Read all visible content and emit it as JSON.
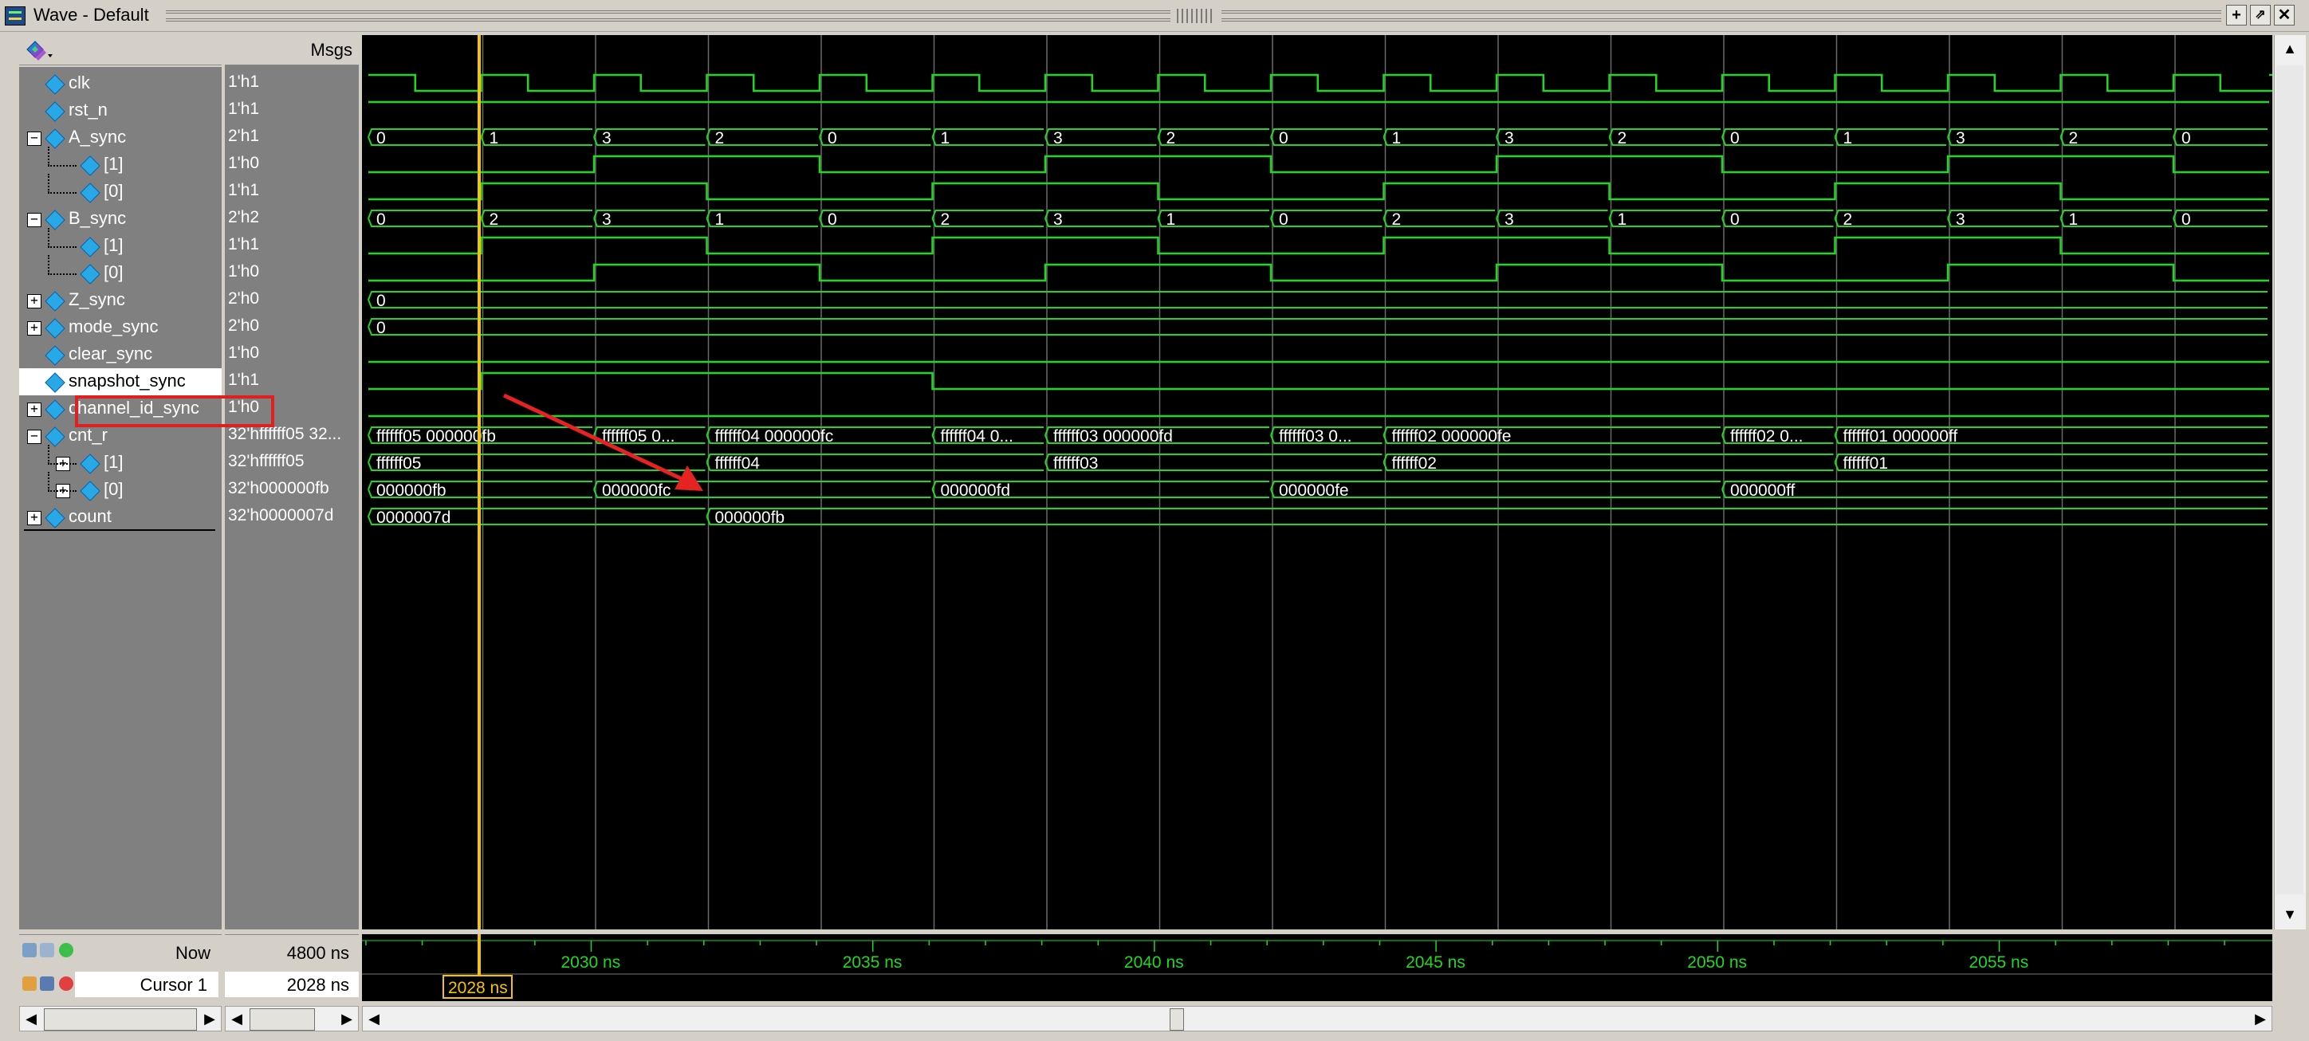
{
  "window": {
    "title": "Wave - Default"
  },
  "headers": {
    "msgs": "Msgs"
  },
  "signals": [
    {
      "name": "clk",
      "value": "1'h1",
      "expand": "",
      "level": 0
    },
    {
      "name": "rst_n",
      "value": "1'h1",
      "expand": "",
      "level": 0
    },
    {
      "name": "A_sync",
      "value": "2'h1",
      "expand": "-",
      "level": 0
    },
    {
      "name": "[1]",
      "value": "1'h0",
      "expand": "",
      "level": 1
    },
    {
      "name": "[0]",
      "value": "1'h1",
      "expand": "",
      "level": 1
    },
    {
      "name": "B_sync",
      "value": "2'h2",
      "expand": "-",
      "level": 0
    },
    {
      "name": "[1]",
      "value": "1'h1",
      "expand": "",
      "level": 1
    },
    {
      "name": "[0]",
      "value": "1'h0",
      "expand": "",
      "level": 1
    },
    {
      "name": "Z_sync",
      "value": "2'h0",
      "expand": "+",
      "level": 0
    },
    {
      "name": "mode_sync",
      "value": "2'h0",
      "expand": "+",
      "level": 0
    },
    {
      "name": "clear_sync",
      "value": "1'h0",
      "expand": "",
      "level": 0
    },
    {
      "name": "snapshot_sync",
      "value": "1'h1",
      "expand": "",
      "level": 0
    },
    {
      "name": "channel_id_sync",
      "value": "1'h0",
      "expand": "+",
      "level": 0
    },
    {
      "name": "cnt_r",
      "value": "32'hffffff05 32...",
      "expand": "-",
      "level": 0
    },
    {
      "name": "[1]",
      "value": "32'hffffff05",
      "expand": "+",
      "level": 1
    },
    {
      "name": "[0]",
      "value": "32'h000000fb",
      "expand": "+",
      "level": 1
    },
    {
      "name": "count",
      "value": "32'h0000007d",
      "expand": "+",
      "level": 0
    }
  ],
  "wave_labels": {
    "A_sync": [
      "0",
      "1",
      "3",
      "2",
      "0",
      "1",
      "3",
      "2",
      "0",
      "1",
      "3",
      "2",
      "0",
      "1",
      "3",
      "2",
      "0"
    ],
    "B_sync": [
      "0",
      "2",
      "3",
      "1",
      "0",
      "2",
      "3",
      "1",
      "0",
      "2",
      "3",
      "1",
      "0",
      "2",
      "3",
      "1",
      "0"
    ],
    "Z_sync": [
      "0"
    ],
    "mode_sync": [
      "0"
    ],
    "cnt_r": [
      "ffffff05 000000fb",
      "ffffff05 0...",
      "ffffff04 000000fc",
      "ffffff04 0...",
      "ffffff03 000000fd",
      "ffffff03 0...",
      "ffffff02 000000fe",
      "ffffff02 0...",
      "ffffff01 000000ff"
    ],
    "cnt_r_1": [
      "ffffff05",
      "ffffff04",
      "ffffff03",
      "ffffff02",
      "ffffff01"
    ],
    "cnt_r_0": [
      "000000fb",
      "000000fc",
      "000000fd",
      "000000fe",
      "000000ff"
    ],
    "count": [
      "0000007d",
      "000000fb"
    ]
  },
  "timeline": {
    "ticks": [
      "2030 ns",
      "2035 ns",
      "2040 ns",
      "2045 ns",
      "2050 ns",
      "2055 ns"
    ],
    "now_label": "Now",
    "now_value": "4800 ns",
    "cursor_label": "Cursor 1",
    "cursor_value": "2028 ns",
    "cursor_tag": "2028 ns"
  },
  "colors": {
    "wave": "#21d821",
    "cursor": "#f5c400",
    "highlight": "#e02020",
    "arrow": "#e62222"
  }
}
